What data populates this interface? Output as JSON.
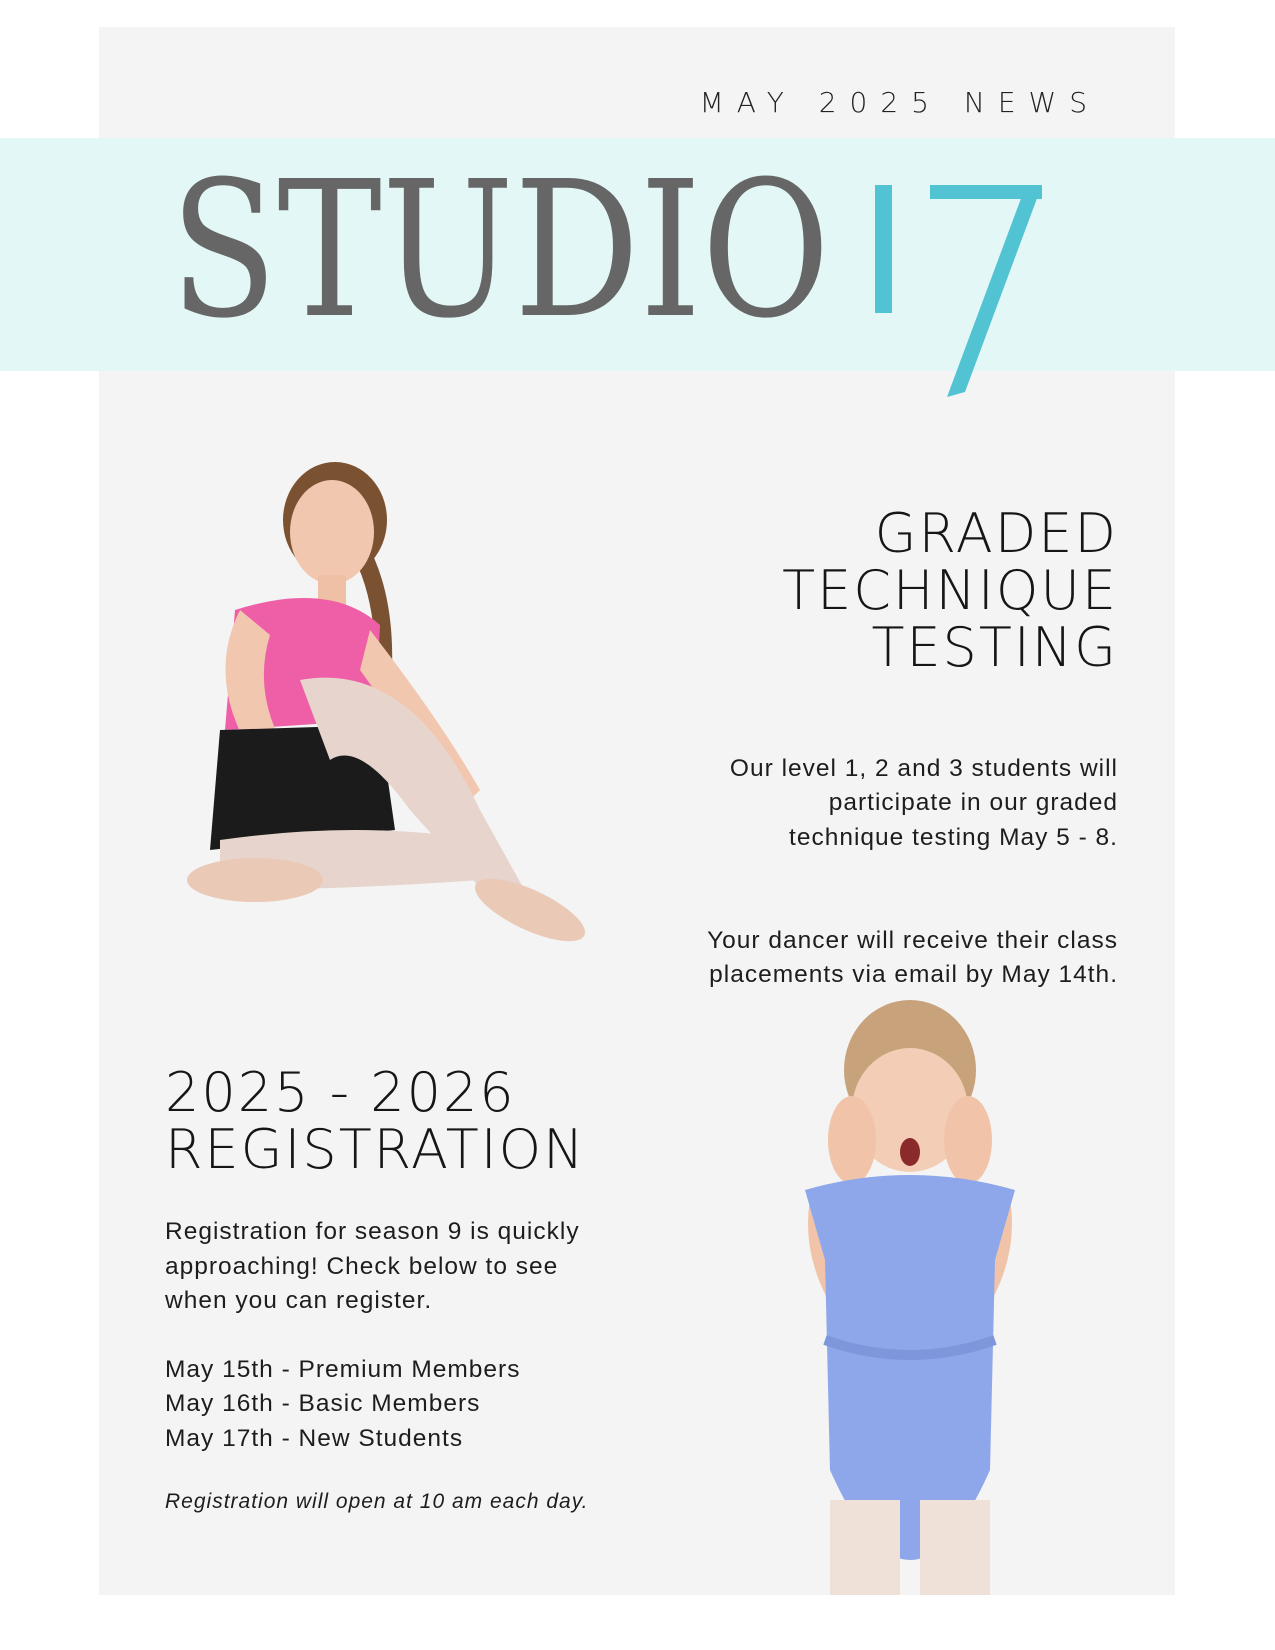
{
  "header": {
    "issue_label": "MAY 2025 NEWS",
    "logo_text": "STUDIO 17",
    "logo_word": "STUDIO",
    "logo_number": "17"
  },
  "colors": {
    "logo_gray": "#666666",
    "logo_teal": "#52c3d2",
    "band": "#e3f7f7",
    "card": "#f4f4f4"
  },
  "testing": {
    "title": "GRADED\nTECHNIQUE\nTESTING",
    "paragraph_1": "Our level 1, 2 and 3 students will\nparticipate in our graded\ntechnique testing May 5 - 8.",
    "paragraph_2": "Your dancer will receive their class\nplacements via email by May 14th."
  },
  "registration": {
    "title": "2025 - 2026\nREGISTRATION",
    "intro": "Registration for season 9 is quickly\napproaching! Check below to see\nwhen you can register.",
    "dates": [
      "May 15th - Premium Members",
      "May 16th - Basic Members",
      "May 17th - New Students"
    ],
    "note": "Registration will open at 10 am each day."
  }
}
